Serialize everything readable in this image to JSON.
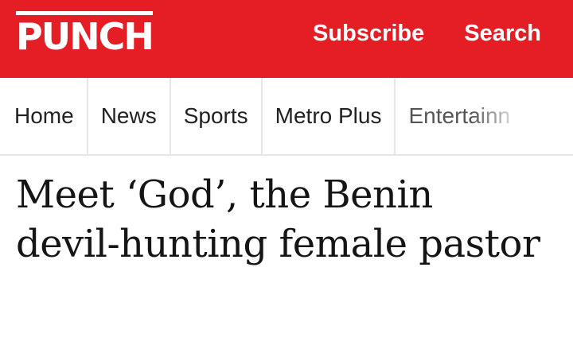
{
  "brand": {
    "logo_text": "PUNCH",
    "accent_color": "#e51e25"
  },
  "header": {
    "subscribe_label": "Subscribe",
    "search_label": "Search"
  },
  "nav": {
    "items": [
      "Home",
      "News",
      "Sports",
      "Metro Plus",
      "Entertainn"
    ]
  },
  "article": {
    "headline": "Meet ‘God’, the Benin devil-hunting female pastor"
  }
}
